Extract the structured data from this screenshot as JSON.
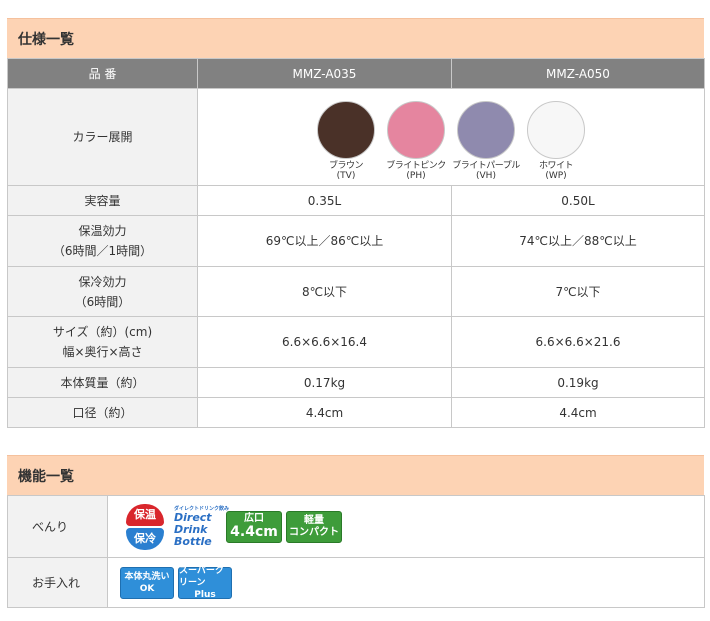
{
  "spec": {
    "heading": "仕様一覧",
    "header": {
      "col0": "品 番",
      "col1": "MMZ-A035",
      "col2": "MMZ-A050"
    },
    "color_label": "カラー展開",
    "colors": [
      {
        "name": "ブラウン",
        "code": "(TV)",
        "hex": "#4a3128"
      },
      {
        "name": "ブライトピンク",
        "code": "(PH)",
        "hex": "#e5859f"
      },
      {
        "name": "ブライトパープル",
        "code": "(VH)",
        "hex": "#8f8aae"
      },
      {
        "name": "ホワイト",
        "code": "(WP)",
        "hex": "#f7f7f7"
      }
    ],
    "rows": [
      {
        "label1": "実容量",
        "label2": "",
        "v1": "0.35L",
        "v2": "0.50L"
      },
      {
        "label1": "保温効力",
        "label2": "（6時間／1時間）",
        "v1": "69℃以上／86℃以上",
        "v2": "74℃以上／88℃以上"
      },
      {
        "label1": "保冷効力",
        "label2": "（6時間）",
        "v1": "8℃以下",
        "v2": "7℃以下"
      },
      {
        "label1": "サイズ（約）(cm)",
        "label2": "幅×奥行×高さ",
        "v1": "6.6×6.6×16.4",
        "v2": "6.6×6.6×21.6"
      },
      {
        "label1": "本体質量（約）",
        "label2": "",
        "v1": "0.17kg",
        "v2": "0.19kg"
      },
      {
        "label1": "口径（約）",
        "label2": "",
        "v1": "4.4cm",
        "v2": "4.4cm"
      }
    ]
  },
  "features": {
    "heading": "機能一覧",
    "benri_label": "べんり",
    "care_label": "お手入れ",
    "hoon": {
      "top": "保温",
      "bottom": "保冷"
    },
    "ddb": {
      "small": "ダイレクトドリンク飲み",
      "l1": "Direct",
      "l2": "Drink",
      "l3": "Bottle"
    },
    "wide_mouth": {
      "l1": "広口",
      "l2": "4.4cm"
    },
    "compact": {
      "l1": "軽量",
      "l2": "コンパクト"
    },
    "wash": {
      "l1": "本体丸洗い",
      "l2": "OK"
    },
    "super_clean": {
      "l1": "スーパークリーン",
      "l2": "Plus"
    }
  }
}
